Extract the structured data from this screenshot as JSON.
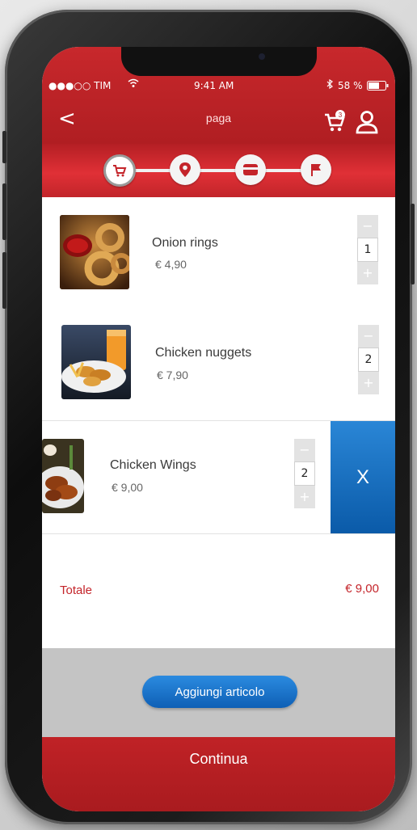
{
  "status_bar": {
    "carrier": "●●●○○ TIM",
    "time": "9:41 AM",
    "battery": "58 %"
  },
  "header": {
    "back_label": "<",
    "title": "paga",
    "cart_badge": "3"
  },
  "steps": [
    {
      "icon": "cart-icon",
      "active": true
    },
    {
      "icon": "location-pin-icon",
      "active": false
    },
    {
      "icon": "credit-card-icon",
      "active": false
    },
    {
      "icon": "flag-icon",
      "active": false
    }
  ],
  "items": [
    {
      "name": "Onion rings",
      "price": "€ 4,90",
      "qty": "1",
      "minus": "−",
      "plus": "+"
    },
    {
      "name": "Chicken nuggets",
      "price": "€ 7,90",
      "qty": "2",
      "minus": "−",
      "plus": "+"
    },
    {
      "name": "Chicken Wings",
      "price": "€ 9,00",
      "qty": "2",
      "minus": "−",
      "plus": "+"
    }
  ],
  "delete_label": "X",
  "totals": {
    "label": "Totale",
    "value": "€ 9,00"
  },
  "add_button": "Aggiungi articolo",
  "continue_button": "Continua",
  "colors": {
    "brand_red": "#c4242a",
    "accent_blue": "#0e5fb5"
  }
}
